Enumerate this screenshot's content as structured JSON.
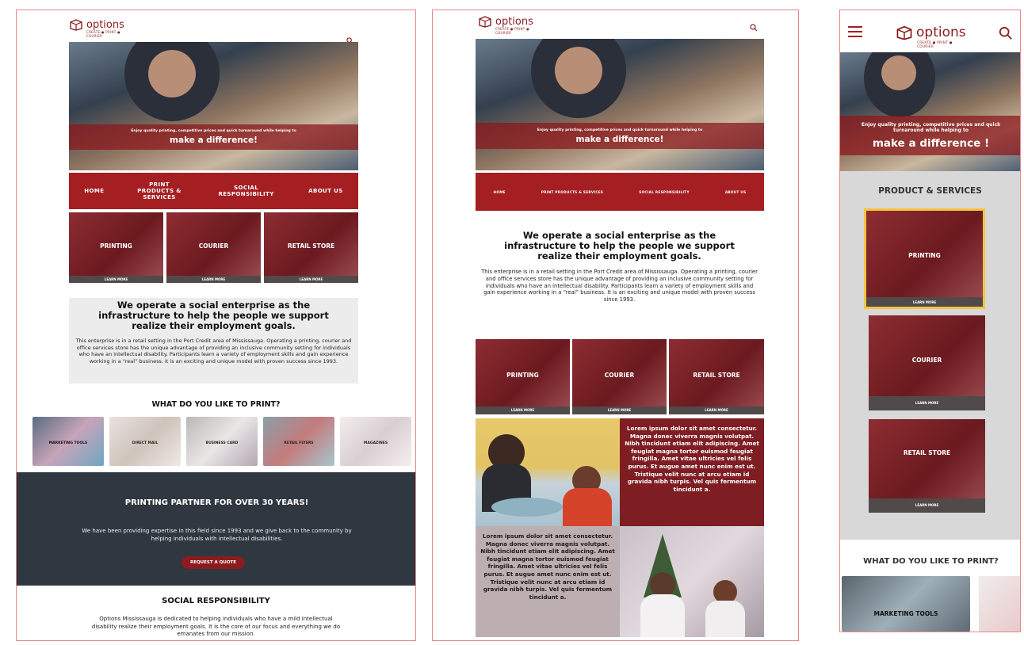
{
  "brand": {
    "name": "options",
    "tagline": "CREATE ● PRINT ● COURIER"
  },
  "hero": {
    "small": "Enjoy quality printing, competitive prices and quick turnaround while helping to",
    "big": "make a difference!",
    "big_mobile": "make a difference !",
    "small_mobile": "Enjoy quality printing, competitive prices and quick turnaround while helping to"
  },
  "nav": {
    "home": "HOME",
    "print_products": "PRINT PRODUCTS & SERVICES",
    "social": "SOCIAL RESPONSIBILITY",
    "about": "ABOUT US"
  },
  "services": {
    "printing": "PRINTING",
    "courier": "COURIER",
    "retail": "RETAIL STORE",
    "learn_more": "LEARN MORE",
    "section_title_mobile": "PRODUCT & SERVICES"
  },
  "mission": {
    "heading": "We operate a social enterprise as the infrastructure to help the people we support realize their employment goals.",
    "body": "This enterprise is in a retail setting in the Port Credit area of Mississauga. Operating a printing, courier and office services store has the unique advantage of providing an inclusive community setting for individuals who have an intellectual disability. Participants learn a variety of employment skills and gain experience working in a “real” business. It is an exciting and unique model with proven success since 1993."
  },
  "print_section": {
    "title": "WHAT DO YOU LIKE TO PRINT?",
    "items": [
      "MARKETING TOOLS",
      "DIRECT MAIL",
      "BUSINESS CARD",
      "RETAIL FLYERS",
      "MAGAZINES"
    ]
  },
  "partner": {
    "title": "PRINTING PARTNER FOR OVER 30 YEARS!",
    "body": "We have been providing expertise in this field since 1993 and we give back to the community by helping individuals with intellectual disabilities.",
    "button": "REQUEST A QUOTE"
  },
  "social": {
    "title": "SOCIAL RESPONSIBILITY",
    "body": "Options Mississauga is dedicated to helping individuals who have a mild intellectual disability realize their employment goals. It is the core of our focus and everything we do emanates from our mission."
  },
  "lorem": "Lorem ipsum dolor sit amet consectetur. Magna donec viverra magnis volutpat. Nibh tincidunt etiam elit adipiscing. Amet feugiat magna tortor euismod feugiat fringilla. Amet vitae ultricies vel felis purus. Et augue amet nunc enim est ut. Tristique velit nunc at arcu etiam id gravida nibh turpis. Vel quis fermentum tincidunt a.",
  "colors": {
    "brand_red": "#a51e22",
    "dark_red": "#8c1b1f",
    "charcoal": "#2f3740",
    "highlight": "#f5c542",
    "frame": "#e6888b"
  }
}
